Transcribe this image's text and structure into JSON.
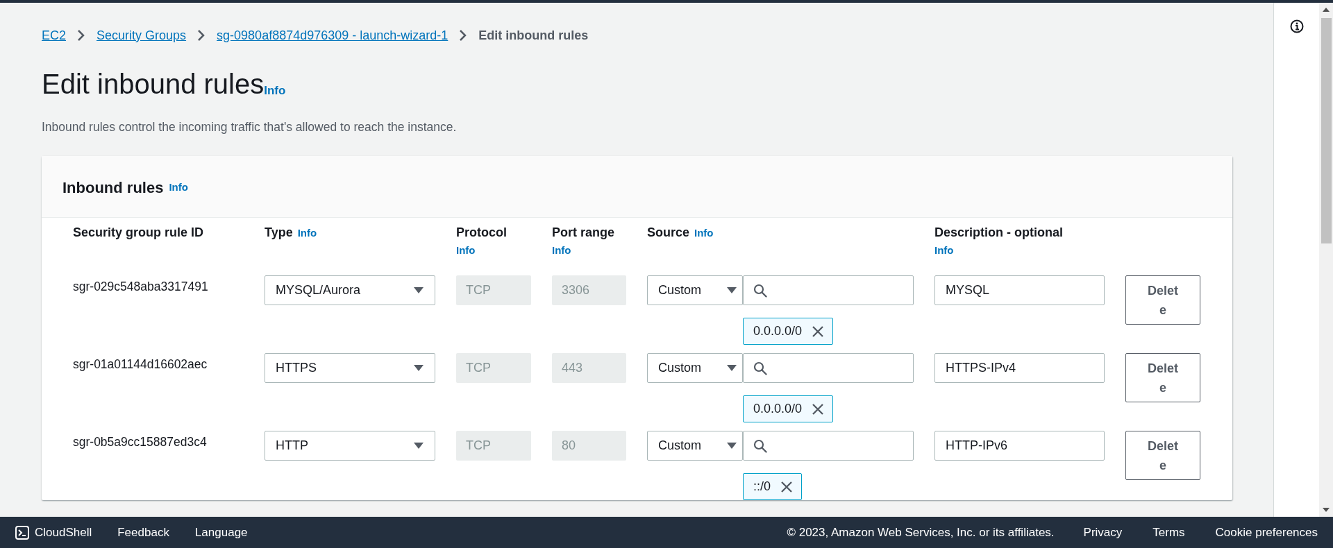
{
  "breadcrumbs": [
    {
      "label": "EC2",
      "kind": "link"
    },
    {
      "label": "Security Groups",
      "kind": "link"
    },
    {
      "label": "sg-0980af8874d976309 - launch-wizard-1",
      "kind": "link"
    },
    {
      "label": "Edit inbound rules",
      "kind": "current"
    }
  ],
  "page": {
    "title": "Edit inbound rules",
    "info": "Info",
    "description": "Inbound rules control the incoming traffic that's allowed to reach the instance."
  },
  "panel": {
    "title": "Inbound rules",
    "info": "Info",
    "columns": [
      {
        "label": "Security group rule ID"
      },
      {
        "label": "Type",
        "info": "Info"
      },
      {
        "label": "Protocol",
        "info": "Info"
      },
      {
        "label": "Port range",
        "info": "Info"
      },
      {
        "label": "Source",
        "info": "Info"
      },
      {
        "label": "Description - optional",
        "info": "Info"
      }
    ],
    "rows": [
      {
        "rule_id": "sgr-029c548aba3317491",
        "type": "MYSQL/Aurora",
        "protocol": "TCP",
        "port_range": "3306",
        "source": "Custom",
        "tokens": [
          "0.0.0.0/0"
        ],
        "description": "MYSQL",
        "delete": "Delete"
      },
      {
        "rule_id": "sgr-01a01144d16602aec",
        "type": "HTTPS",
        "protocol": "TCP",
        "port_range": "443",
        "source": "Custom",
        "tokens": [
          "0.0.0.0/0"
        ],
        "description": "HTTPS-IPv4",
        "delete": "Delete"
      },
      {
        "rule_id": "sgr-0b5a9cc15887ed3c4",
        "type": "HTTP",
        "protocol": "TCP",
        "port_range": "80",
        "source": "Custom",
        "tokens": [
          "::/0"
        ],
        "description": "HTTP-IPv6",
        "delete": "Delete"
      }
    ]
  },
  "footer": {
    "cloudshell": "CloudShell",
    "links": [
      "Feedback",
      "Language"
    ],
    "copyright": "© 2023, Amazon Web Services, Inc. or its affiliates.",
    "right_links": [
      "Privacy",
      "Terms",
      "Cookie preferences"
    ]
  }
}
